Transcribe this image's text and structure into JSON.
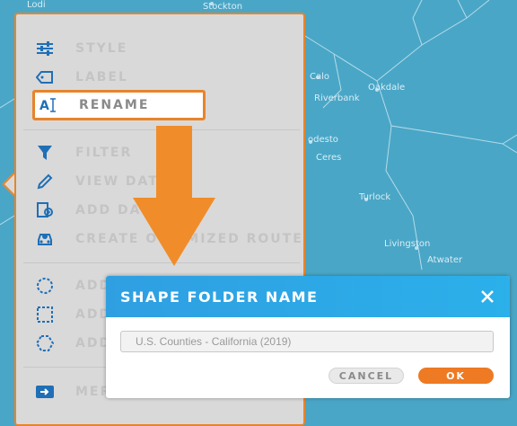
{
  "map": {
    "places": [
      "Stockton",
      "Lodi",
      "Calo",
      "Oakdale",
      "Riverbank",
      "odesto",
      "Ceres",
      "Turlock",
      "Livingston",
      "Atwater"
    ]
  },
  "menu": {
    "items": [
      {
        "label": "STYLE",
        "icon": "sliders-icon"
      },
      {
        "label": "LABEL",
        "icon": "tag-icon"
      },
      {
        "label": "RENAME",
        "icon": "rename-text-icon"
      },
      {
        "label": "FILTER",
        "icon": "funnel-icon"
      },
      {
        "label": "VIEW DATA",
        "icon": "pencil-icon"
      },
      {
        "label": "ADD DA",
        "icon": "add-data-icon"
      },
      {
        "label": "CREATE OPTIMIZED ROUTE",
        "icon": "route-car-icon"
      },
      {
        "label": "ADD",
        "icon": "dashed-circle-icon"
      },
      {
        "label": "ADD",
        "icon": "dashed-square-icon"
      },
      {
        "label": "ADD",
        "icon": "dashed-hexagon-icon"
      },
      {
        "label": "MER",
        "icon": "merge-icon"
      }
    ]
  },
  "dialog": {
    "title": "SHAPE FOLDER NAME",
    "input_value": "U.S. Counties - California (2019)",
    "cancel_label": "CANCEL",
    "ok_label": "OK"
  },
  "colors": {
    "accent": "#e8842a",
    "header": "#2f9fe2",
    "icon": "#1f6fb6",
    "map": "#4aa6c6"
  }
}
